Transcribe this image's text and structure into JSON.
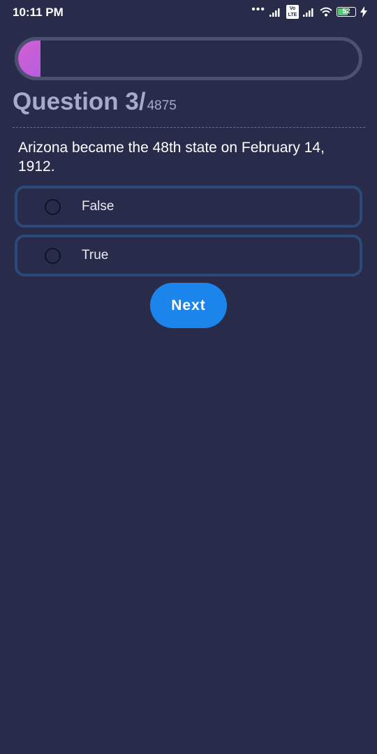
{
  "status_bar": {
    "time": "10:11 PM",
    "volte_label": "Vo LTE",
    "battery_level": "52"
  },
  "progress": {
    "fraction": 0.0006
  },
  "question": {
    "label": "Question 3/",
    "total": "4875",
    "text": "Arizona became the 48th state on February 14, 1912."
  },
  "options": [
    {
      "label": "False"
    },
    {
      "label": "True"
    }
  ],
  "next_button": {
    "label": "Next"
  },
  "colors": {
    "background": "#282b4a",
    "progress_fill": "#d65fd1",
    "option_border": "#2a4a78",
    "accent": "#1b85eb"
  }
}
